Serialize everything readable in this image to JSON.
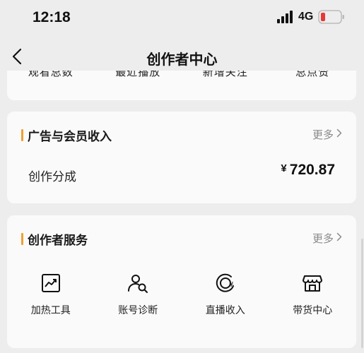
{
  "status": {
    "time": "12:18",
    "network": "4G"
  },
  "nav": {
    "title": "创作者中心"
  },
  "top_card": {
    "items": [
      "观看总数",
      "最近播放",
      "新增关注",
      "总点赞"
    ]
  },
  "ad_section": {
    "title": "广告与会员收入",
    "more": "更多",
    "revenue_label": "创作分成",
    "currency": "¥",
    "revenue_value": "720.87"
  },
  "service_section": {
    "title": "创作者服务",
    "more": "更多",
    "tools": [
      {
        "label": "加热工具",
        "icon": "trend-chart-icon"
      },
      {
        "label": "账号诊断",
        "icon": "user-search-icon"
      },
      {
        "label": "直播收入",
        "icon": "live-income-icon"
      },
      {
        "label": "带货中心",
        "icon": "store-icon"
      }
    ]
  },
  "colors": {
    "accent": "#f0a030",
    "background": "#ededed",
    "card": "#fafafa"
  }
}
